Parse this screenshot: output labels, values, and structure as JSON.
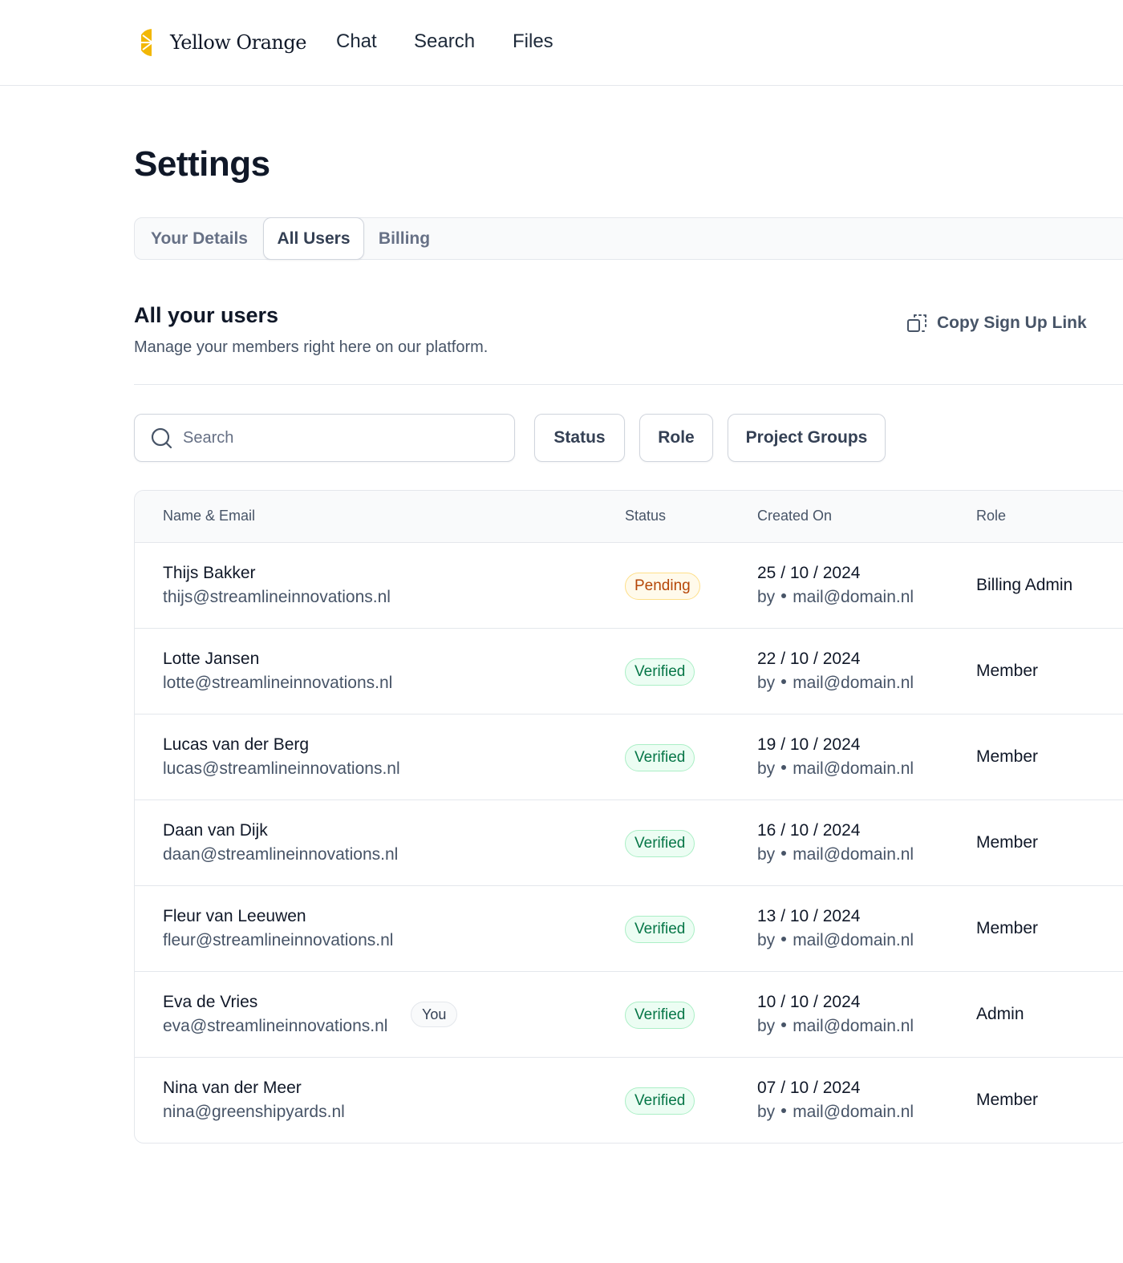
{
  "brand": {
    "name": "Yellow Orange",
    "accent": "#F2B705"
  },
  "nav": {
    "links": [
      "Chat",
      "Search",
      "Files"
    ]
  },
  "page": {
    "title": "Settings"
  },
  "tabs": [
    {
      "label": "Your Details",
      "active": false
    },
    {
      "label": "All Users",
      "active": true
    },
    {
      "label": "Billing",
      "active": false
    }
  ],
  "section": {
    "title": "All your users",
    "subtitle": "Manage your members right here on our platform.",
    "copy_link_label": "Copy Sign Up Link"
  },
  "filters": {
    "search_placeholder": "Search",
    "buttons": [
      "Status",
      "Role",
      "Project Groups"
    ]
  },
  "table": {
    "columns": [
      "Name & Email",
      "Status",
      "Created On",
      "Role"
    ],
    "rows": [
      {
        "name": "Thijs Bakker",
        "email": "thijs@streamlineinnovations.nl",
        "you": "",
        "status": "Pending",
        "status_type": "pending",
        "date": "25 / 10 / 2024",
        "by_prefix": "by",
        "by_email": "mail@domain.nl",
        "role": "Billing Admin"
      },
      {
        "name": "Lotte Jansen",
        "email": "lotte@streamlineinnovations.nl",
        "you": "",
        "status": "Verified",
        "status_type": "verified",
        "date": "22 / 10 / 2024",
        "by_prefix": "by",
        "by_email": "mail@domain.nl",
        "role": "Member"
      },
      {
        "name": "Lucas van der Berg",
        "email": "lucas@streamlineinnovations.nl",
        "you": "",
        "status": "Verified",
        "status_type": "verified",
        "date": "19 / 10 / 2024",
        "by_prefix": "by",
        "by_email": "mail@domain.nl",
        "role": "Member"
      },
      {
        "name": "Daan van Dijk",
        "email": "daan@streamlineinnovations.nl",
        "you": "",
        "status": "Verified",
        "status_type": "verified",
        "date": "16 / 10 / 2024",
        "by_prefix": "by",
        "by_email": "mail@domain.nl",
        "role": "Member"
      },
      {
        "name": "Fleur van Leeuwen",
        "email": "fleur@streamlineinnovations.nl",
        "you": "",
        "status": "Verified",
        "status_type": "verified",
        "date": "13 / 10 / 2024",
        "by_prefix": "by",
        "by_email": "mail@domain.nl",
        "role": "Member"
      },
      {
        "name": "Eva de Vries",
        "email": "eva@streamlineinnovations.nl",
        "you": "You",
        "status": "Verified",
        "status_type": "verified",
        "date": "10 / 10 / 2024",
        "by_prefix": "by",
        "by_email": "mail@domain.nl",
        "role": "Admin"
      },
      {
        "name": "Nina van der Meer",
        "email": "nina@greenshipyards.nl",
        "you": "",
        "status": "Verified",
        "status_type": "verified",
        "date": "07 / 10 / 2024",
        "by_prefix": "by",
        "by_email": "mail@domain.nl",
        "role": "Member"
      }
    ]
  }
}
